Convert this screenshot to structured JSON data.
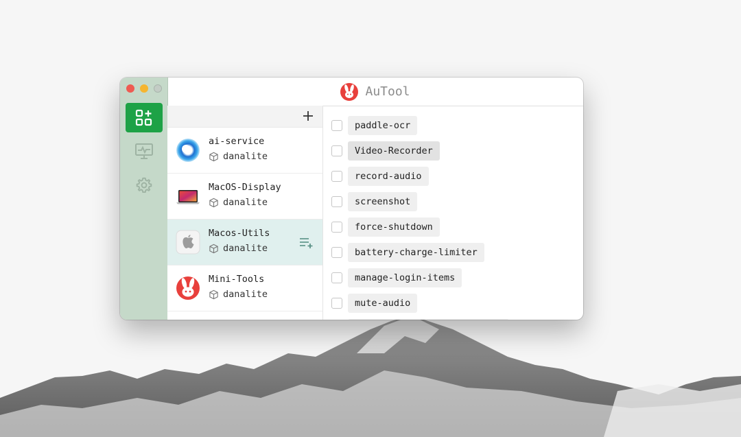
{
  "app": {
    "title": "AuTool"
  },
  "sidebar": {
    "items": [
      {
        "name": "plugins",
        "icon": "apps-add-icon",
        "active": true
      },
      {
        "name": "monitor",
        "icon": "monitor-pulse-icon",
        "active": false
      },
      {
        "name": "settings",
        "icon": "gear-icon",
        "active": false
      }
    ]
  },
  "projects": {
    "add_icon": "plus-icon",
    "items": [
      {
        "name": "ai-service",
        "owner": "danalite",
        "icon": "blue-orb-icon",
        "selected": false
      },
      {
        "name": "MacOS-Display",
        "owner": "danalite",
        "icon": "macbook-icon",
        "selected": false
      },
      {
        "name": "Macos-Utils",
        "owner": "danalite",
        "icon": "apple-logo-icon",
        "selected": true
      },
      {
        "name": "Mini-Tools",
        "owner": "danalite",
        "icon": "rabbit-logo-icon",
        "selected": false
      }
    ]
  },
  "plugins": {
    "items": [
      {
        "label": "paddle-ocr",
        "checked": false
      },
      {
        "label": "Video-Recorder",
        "checked": false
      },
      {
        "label": "record-audio",
        "checked": false
      },
      {
        "label": "screenshot",
        "checked": false
      },
      {
        "label": "force-shutdown",
        "checked": false
      },
      {
        "label": "battery-charge-limiter",
        "checked": false
      },
      {
        "label": "manage-login-items",
        "checked": false
      },
      {
        "label": "mute-audio",
        "checked": false
      }
    ]
  },
  "colors": {
    "accent": "#1da246",
    "sidebar": "#c5d9c9",
    "selected_row": "#e0f0ee",
    "brand_red": "#e8403c"
  }
}
